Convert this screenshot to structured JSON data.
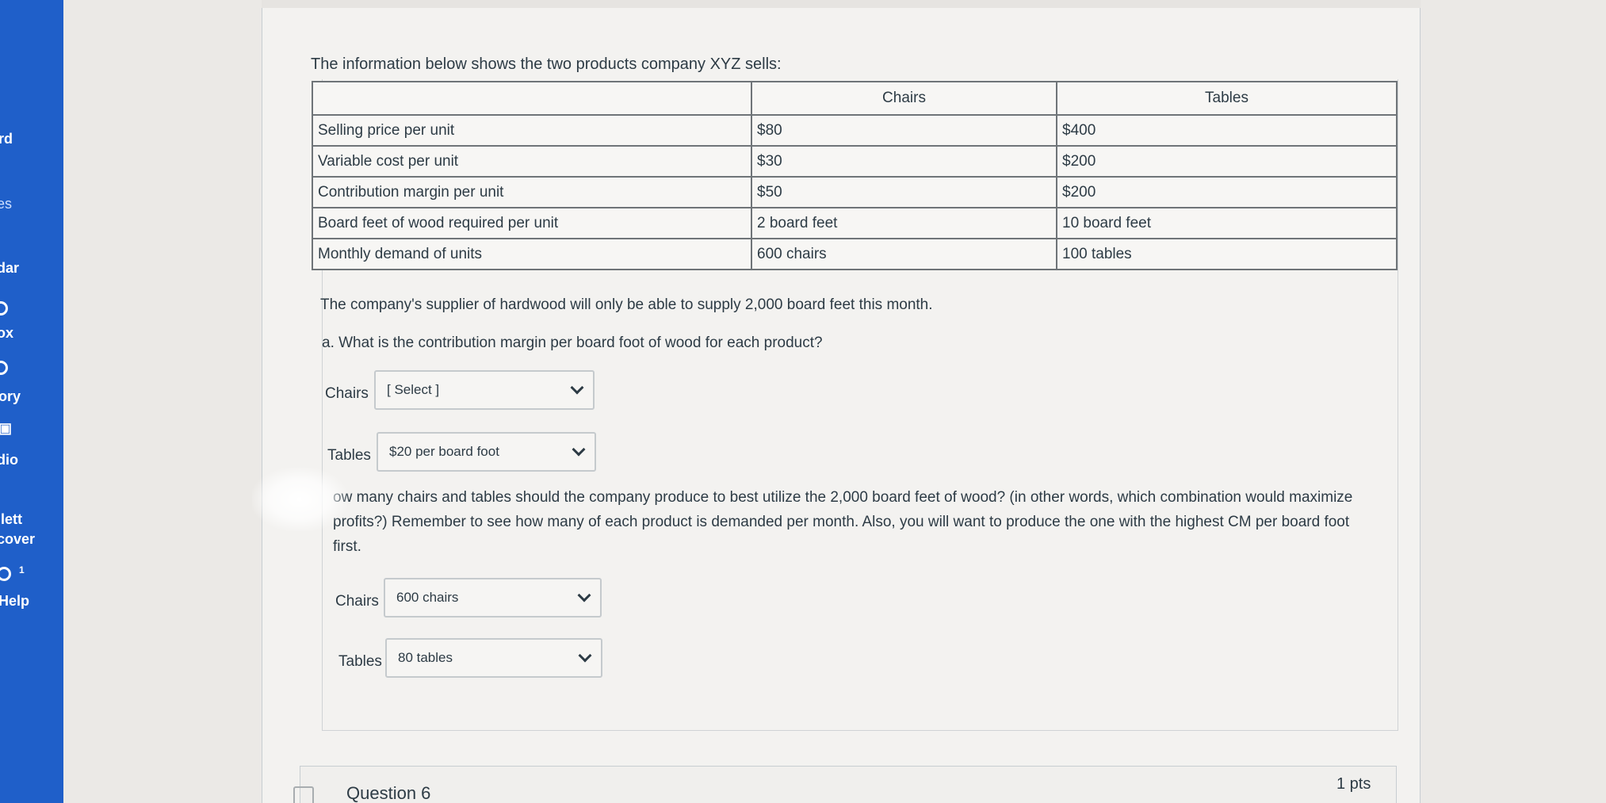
{
  "nav": {
    "items": [
      {
        "label": "rd"
      },
      {
        "label": "es"
      },
      {
        "label": "dar"
      },
      {
        "label": "ox"
      },
      {
        "label": "ory"
      },
      {
        "label": "dio"
      },
      {
        "label": "llett"
      },
      {
        "label": "cover"
      },
      {
        "label": "Help"
      }
    ],
    "help_badge": "1"
  },
  "question": {
    "intro": "The information below shows the two products company XYZ sells:",
    "table": {
      "headers": [
        "",
        "Chairs",
        "Tables"
      ],
      "rows": [
        {
          "label": "Selling price per unit",
          "chairs": "$80",
          "tables": "$400"
        },
        {
          "label": "Variable cost per unit",
          "chairs": "$30",
          "tables": "$200"
        },
        {
          "label": "Contribution margin per unit",
          "chairs": "$50",
          "tables": "$200"
        },
        {
          "label": "Board feet of wood required per unit",
          "chairs": "2 board feet",
          "tables": "10 board feet"
        },
        {
          "label": "Monthly demand of units",
          "chairs": "600 chairs",
          "tables": "100 tables"
        }
      ]
    },
    "supply_note": "The company's supplier of hardwood will only be able to supply 2,000 board feet this month.",
    "part_a": {
      "text": "a. What is the contribution margin per board foot of wood for each product?",
      "chairs_label": "Chairs",
      "chairs_value": "[ Select ]",
      "tables_label": "Tables",
      "tables_value": "$20 per board foot"
    },
    "part_b": {
      "text": "ow many chairs and tables should the company produce to best utilize the 2,000 board feet of wood? (in other words, which combination would maximize profits?) Remember to see how many of each product is demanded per month. Also, you will want to produce the one with the highest CM per board foot first.",
      "chairs_label": "Chairs",
      "chairs_value": "600 chairs",
      "tables_label": "Tables",
      "tables_value": "80 tables"
    }
  },
  "next_question": {
    "title": "Question 6",
    "points": "1 pts"
  }
}
